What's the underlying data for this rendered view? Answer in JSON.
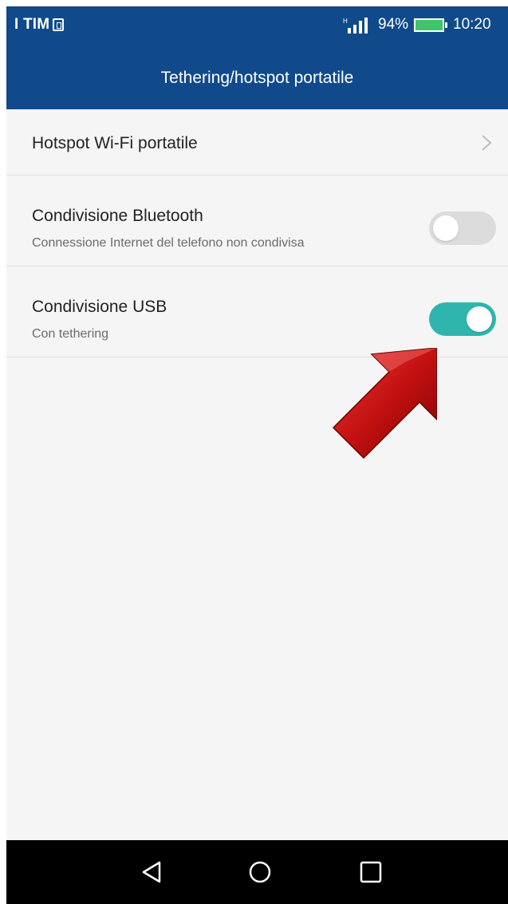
{
  "status_bar": {
    "carrier": "I TIM",
    "battery_percent": "94%",
    "time": "10:20",
    "icons": [
      "sim-icon",
      "signal-icon",
      "battery-icon"
    ]
  },
  "header": {
    "title": "Tethering/hotspot portatile"
  },
  "settings": {
    "items": [
      {
        "title": "Hotspot Wi-Fi portatile",
        "control": "chevron-right-icon"
      },
      {
        "title": "Condivisione Bluetooth",
        "subtitle": "Connessione Internet del telefono non condivisa",
        "toggle_on": false
      },
      {
        "title": "Condivisione USB",
        "subtitle": "Con tethering",
        "toggle_on": true
      }
    ]
  },
  "annotation": {
    "icon": "red-arrow-icon",
    "color": "#cc1111"
  },
  "colors": {
    "header_bg": "#114a8b",
    "toggle_on": "#2fb5ae",
    "toggle_off": "#dcdcdc",
    "background": "#f5f5f5"
  },
  "nav_bar": {
    "buttons": [
      "back-icon",
      "home-icon",
      "recent-apps-icon"
    ]
  }
}
